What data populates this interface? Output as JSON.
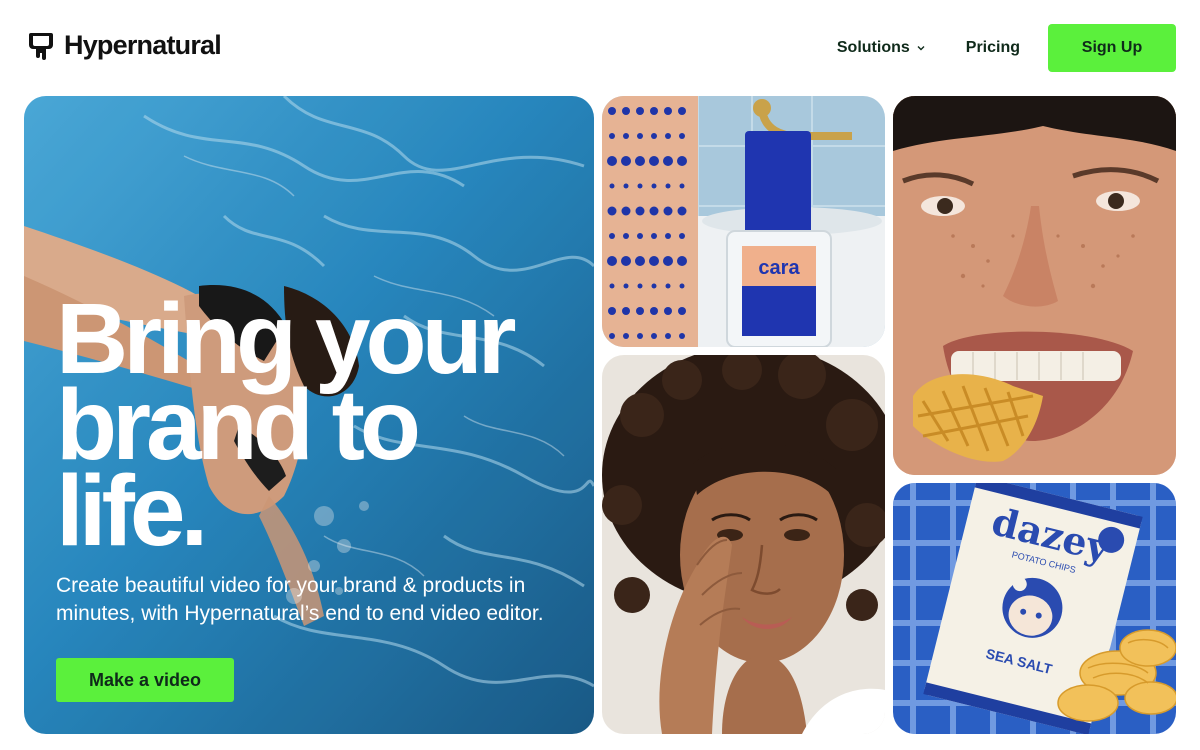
{
  "brand": {
    "name": "Hypernatural",
    "logo_icon": "drip-shield-icon"
  },
  "nav": {
    "solutions_label": "Solutions",
    "solutions_icon": "chevron-down-icon",
    "pricing_label": "Pricing",
    "signup_label": "Sign Up"
  },
  "hero": {
    "title_lines": [
      "Bring your",
      "brand to",
      "life."
    ],
    "subtitle": "Create beautiful video for your brand & products in minutes, with Hypernatural’s end to end video editor.",
    "cta_label": "Make a video"
  },
  "tiles": {
    "perfume_bottle_text": "cara",
    "chips_bag": {
      "brand": "dazey",
      "product": "POTATO CHIPS",
      "flavor": "SEA SALT"
    }
  },
  "colors": {
    "accent": "#5bf03c",
    "text_dark": "#0f2a1a",
    "pool_blue": "#2a8fc9"
  }
}
